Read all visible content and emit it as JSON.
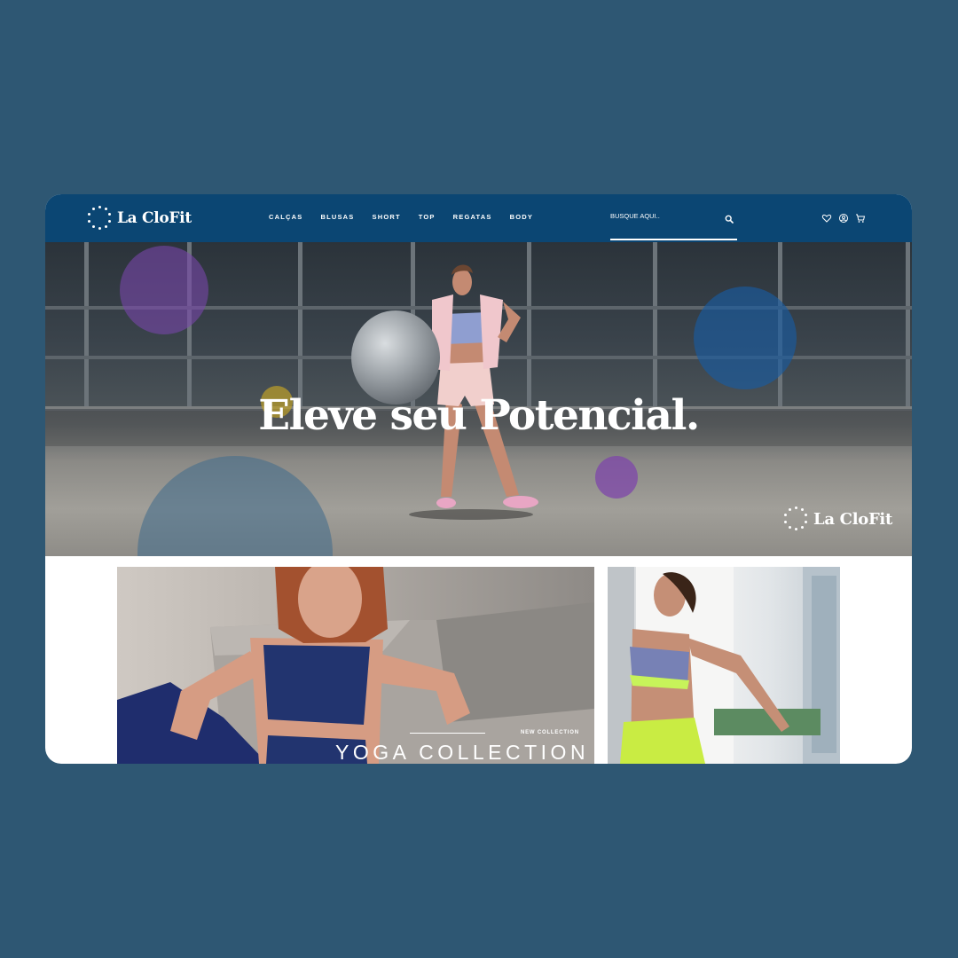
{
  "brand": {
    "name": "La CloFit"
  },
  "nav": {
    "items": [
      "CALÇAS",
      "BLUSAS",
      "SHORT",
      "TOP",
      "REGATAS",
      "BODY"
    ]
  },
  "search": {
    "placeholder": "BUSQUE AQUI..",
    "value": ""
  },
  "actions": [
    "heart-icon",
    "user-icon",
    "cart-icon"
  ],
  "hero": {
    "title": "Eleve seu Potencial.",
    "watermark": "La CloFit"
  },
  "products": {
    "yoga": {
      "badge": "NEW COLLECTION",
      "title": "YOGA COLLECTION"
    }
  },
  "colors": {
    "background": "#2e5773",
    "nav": "#0b4673",
    "accent": "#ffffff"
  }
}
